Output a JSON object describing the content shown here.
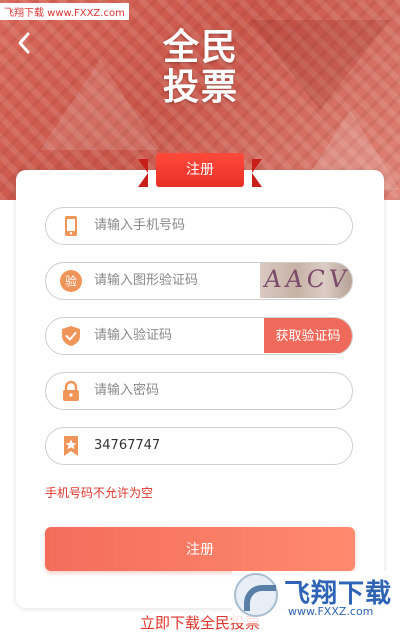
{
  "watermark_top": "飞翔下载 www.FXXZ.com",
  "header": {
    "title_line1": "全民",
    "title_line2": "投票"
  },
  "ribbon_label": "注册",
  "fields": {
    "phone_placeholder": "请输入手机号码",
    "captcha_placeholder": "请输入图形验证码",
    "captcha_text": "AACV",
    "captcha_badge": "验",
    "sms_placeholder": "请输入验证码",
    "get_code_label": "获取验证码",
    "password_placeholder": "请输入密码",
    "invite_value": "34767747"
  },
  "error_text": "手机号码不允许为空",
  "submit_label": "注册",
  "download_text": "立即下载全民投票",
  "watermark_bottom": {
    "title": "飞翔下载",
    "url": "www.FXXZ.com"
  },
  "colors": {
    "accent": "#ef6a5a",
    "error": "#e0352b",
    "ribbon": "#e8302a",
    "icon_orange": "#f0955a"
  }
}
